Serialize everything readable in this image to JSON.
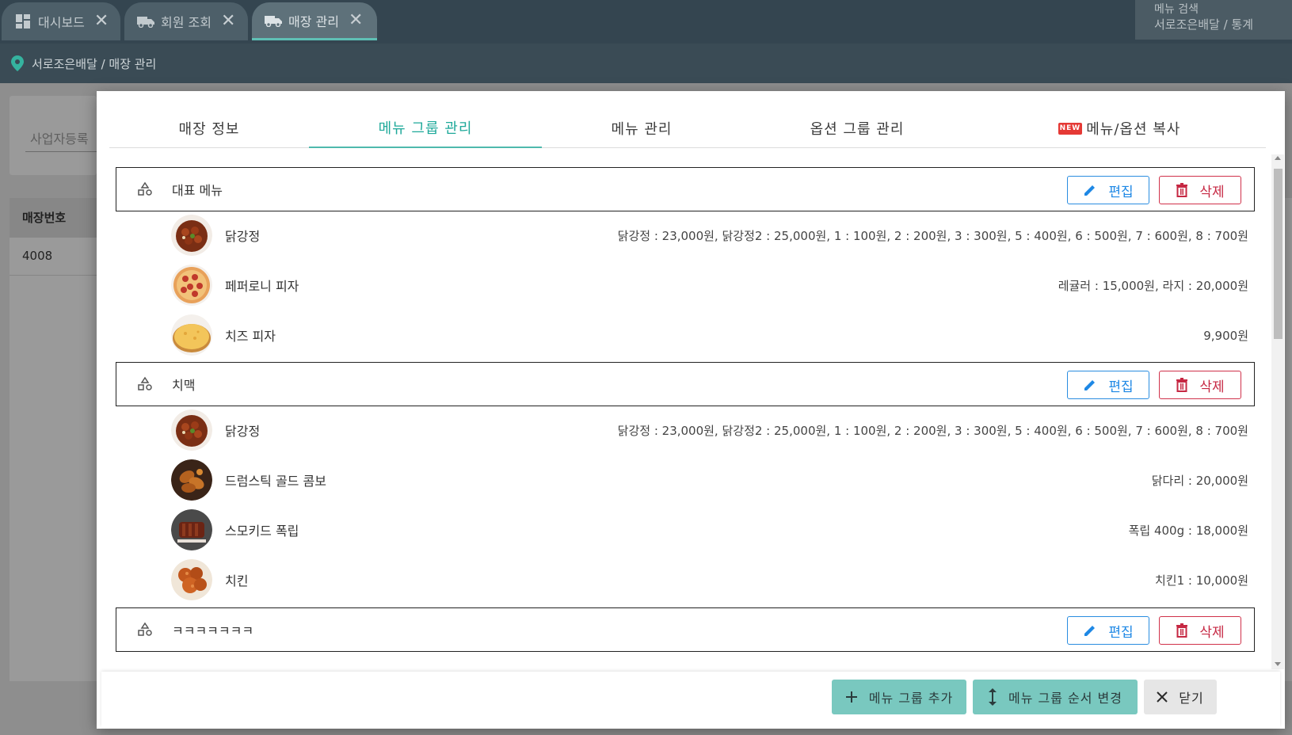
{
  "top_tabs": [
    {
      "label": "대시보드",
      "icon": "dashboard-icon",
      "active": false
    },
    {
      "label": "회원 조회",
      "icon": "truck-icon",
      "active": false
    },
    {
      "label": "매장 관리",
      "icon": "truck-icon",
      "active": true
    }
  ],
  "top_right": {
    "line1": "메뉴 검색",
    "line2": "서로조은배달 / 통계"
  },
  "breadcrumb": "서로조은배달 / 매장 관리",
  "background_page": {
    "search_placeholder": "사업자등록",
    "table_header": "매장번호",
    "table_cell": "4008"
  },
  "modal": {
    "tabs": [
      {
        "label": "매장 정보",
        "active": false
      },
      {
        "label": "메뉴 그룹 관리",
        "active": true
      },
      {
        "label": "메뉴 관리",
        "active": false
      },
      {
        "label": "옵션 그룹 관리",
        "active": false
      },
      {
        "label": "메뉴/옵션 복사",
        "badge": "NEW",
        "active": false
      }
    ],
    "edit_label": "편집",
    "delete_label": "삭제",
    "groups": [
      {
        "name": "대표 메뉴",
        "items": [
          {
            "name": "닭강정",
            "price": "닭강정 : 23,000원, 닭강정2 : 25,000원, 1 : 100원, 2 : 200원, 3 : 300원, 5 : 400원, 6 : 500원, 7 : 600원, 8 : 700원",
            "image": "fried-chicken-image"
          },
          {
            "name": "페퍼로니 피자",
            "price": "레귤러 : 15,000원, 라지 : 20,000원",
            "image": "pepperoni-pizza-image"
          },
          {
            "name": "치즈 피자",
            "price": "9,900원",
            "image": "cheese-pizza-image"
          }
        ]
      },
      {
        "name": "치맥",
        "items": [
          {
            "name": "닭강정",
            "price": "닭강정 : 23,000원, 닭강정2 : 25,000원, 1 : 100원, 2 : 200원, 3 : 300원, 5 : 400원, 6 : 500원, 7 : 600원, 8 : 700원",
            "image": "fried-chicken-image"
          },
          {
            "name": "드럼스틱 골드 콤보",
            "price": "닭다리 : 20,000원",
            "image": "drumstick-image"
          },
          {
            "name": "스모키드 폭립",
            "price": "폭립 400g : 18,000원",
            "image": "pork-ribs-image"
          },
          {
            "name": "치킨",
            "price": "치킨1 : 10,000원",
            "image": "chicken-image"
          }
        ]
      },
      {
        "name": "ㅋㅋㅋㅋㅋㅋㅋ",
        "items": []
      }
    ],
    "footer": {
      "add_group": "메뉴 그룹 추가",
      "reorder_group": "메뉴 그룹 순서 변경",
      "close": "닫기"
    }
  },
  "colors": {
    "accent": "#1fa99a",
    "edit": "#1e88e5",
    "delete": "#c62843",
    "topbar": "#344550"
  }
}
